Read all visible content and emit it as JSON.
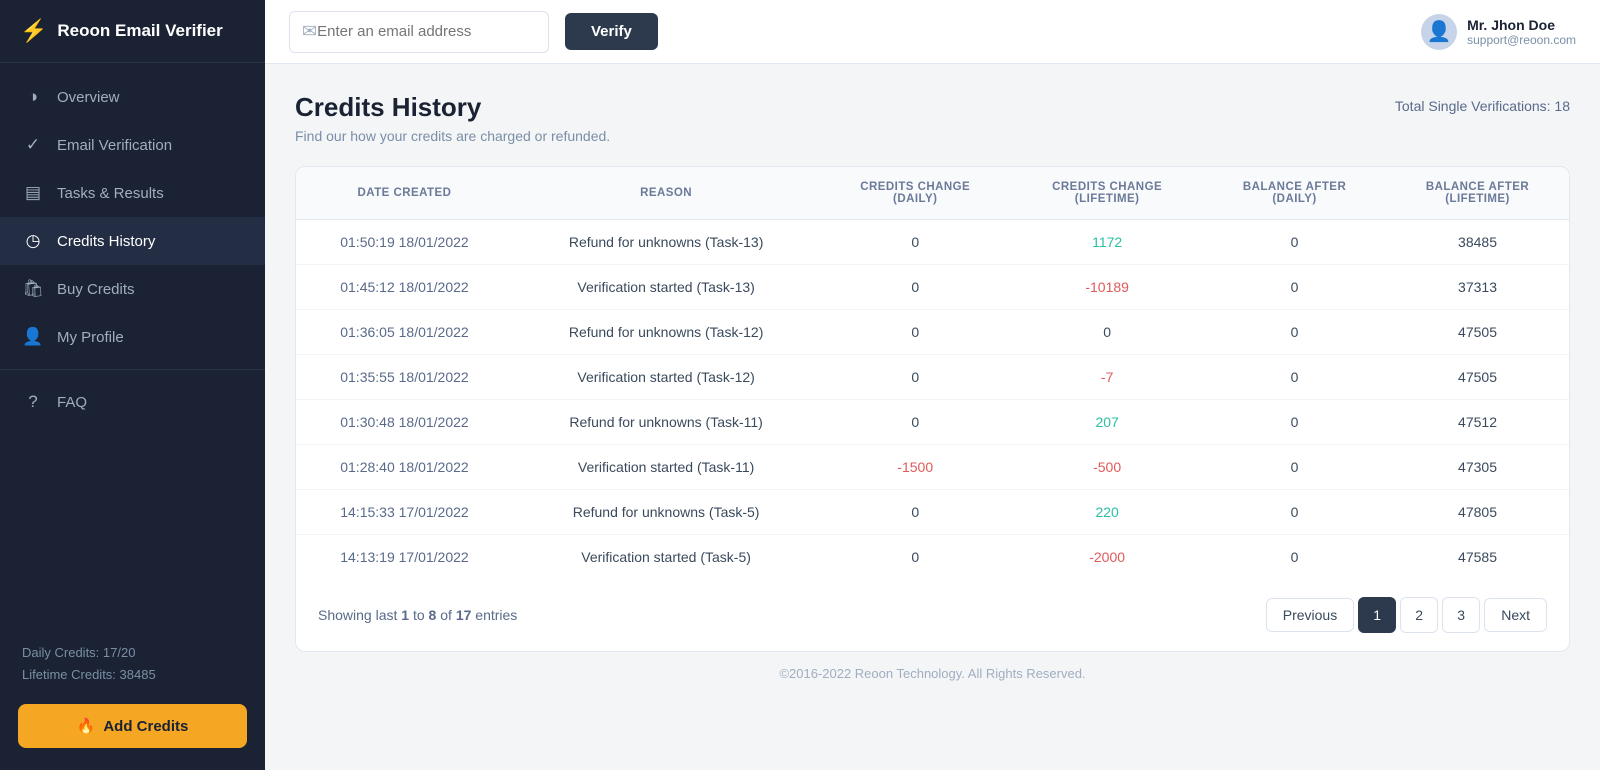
{
  "brand": {
    "name": "Reoon Email Verifier",
    "icon": "⚡"
  },
  "sidebar": {
    "nav_items": [
      {
        "id": "overview",
        "label": "Overview",
        "icon": "◑"
      },
      {
        "id": "email-verification",
        "label": "Email Verification",
        "icon": "✓"
      },
      {
        "id": "tasks-results",
        "label": "Tasks & Results",
        "icon": "▤"
      },
      {
        "id": "credits-history",
        "label": "Credits History",
        "icon": "◷",
        "active": true
      },
      {
        "id": "buy-credits",
        "label": "Buy Credits",
        "icon": "🛍"
      },
      {
        "id": "my-profile",
        "label": "My Profile",
        "icon": "👤"
      },
      {
        "id": "faq",
        "label": "FAQ",
        "icon": "?"
      }
    ],
    "daily_credits_label": "Daily Credits: 17/20",
    "lifetime_credits_label": "Lifetime Credits: 38485",
    "add_credits_label": "Add Credits",
    "add_credits_icon": "🔥"
  },
  "topbar": {
    "email_placeholder": "Enter an email address",
    "verify_label": "Verify",
    "user": {
      "name": "Mr. Jhon Doe",
      "email": "support@reoon.com"
    }
  },
  "page": {
    "title": "Credits History",
    "subtitle": "Find our how your credits are charged or refunded.",
    "total_verifications_label": "Total Single Verifications: 18"
  },
  "table": {
    "columns": [
      {
        "id": "date_created",
        "label": "DATE CREATED"
      },
      {
        "id": "reason",
        "label": "REASON"
      },
      {
        "id": "credits_change_daily",
        "label": "CREDITS CHANGE\n(DAILY)"
      },
      {
        "id": "credits_change_lifetime",
        "label": "CREDITS CHANGE\n(LIFETIME)"
      },
      {
        "id": "balance_after_daily",
        "label": "BALANCE AFTER\n(DAILY)"
      },
      {
        "id": "balance_after_lifetime",
        "label": "BALANCE AFTER\n(LIFETIME)"
      }
    ],
    "rows": [
      {
        "date": "01:50:19 18/01/2022",
        "reason": "Refund for unknowns (Task-13)",
        "credits_change_daily": "0",
        "credits_change_lifetime": "1172",
        "balance_after_daily": "0",
        "balance_after_lifetime": "38485",
        "lifetime_positive": true,
        "daily_negative": false
      },
      {
        "date": "01:45:12 18/01/2022",
        "reason": "Verification started (Task-13)",
        "credits_change_daily": "0",
        "credits_change_lifetime": "-10189",
        "balance_after_daily": "0",
        "balance_after_lifetime": "37313",
        "lifetime_positive": false,
        "daily_negative": false
      },
      {
        "date": "01:36:05 18/01/2022",
        "reason": "Refund for unknowns (Task-12)",
        "credits_change_daily": "0",
        "credits_change_lifetime": "0",
        "balance_after_daily": "0",
        "balance_after_lifetime": "47505",
        "lifetime_positive": false,
        "daily_negative": false
      },
      {
        "date": "01:35:55 18/01/2022",
        "reason": "Verification started (Task-12)",
        "credits_change_daily": "0",
        "credits_change_lifetime": "-7",
        "balance_after_daily": "0",
        "balance_after_lifetime": "47505",
        "lifetime_positive": false,
        "daily_negative": false
      },
      {
        "date": "01:30:48 18/01/2022",
        "reason": "Refund for unknowns (Task-11)",
        "credits_change_daily": "0",
        "credits_change_lifetime": "207",
        "balance_after_daily": "0",
        "balance_after_lifetime": "47512",
        "lifetime_positive": true,
        "daily_negative": false
      },
      {
        "date": "01:28:40 18/01/2022",
        "reason": "Verification started (Task-11)",
        "credits_change_daily": "-1500",
        "credits_change_lifetime": "-500",
        "balance_after_daily": "0",
        "balance_after_lifetime": "47305",
        "lifetime_positive": false,
        "daily_negative": true
      },
      {
        "date": "14:15:33 17/01/2022",
        "reason": "Refund for unknowns (Task-5)",
        "credits_change_daily": "0",
        "credits_change_lifetime": "220",
        "balance_after_daily": "0",
        "balance_after_lifetime": "47805",
        "lifetime_positive": true,
        "daily_negative": false
      },
      {
        "date": "14:13:19 17/01/2022",
        "reason": "Verification started (Task-5)",
        "credits_change_daily": "0",
        "credits_change_lifetime": "-2000",
        "balance_after_daily": "0",
        "balance_after_lifetime": "47585",
        "lifetime_positive": false,
        "daily_negative": false
      }
    ],
    "showing_text_pre": "Showing last ",
    "showing_from": "1",
    "showing_to": "8",
    "showing_of": "17",
    "showing_text_post": " entries"
  },
  "pagination": {
    "previous_label": "Previous",
    "next_label": "Next",
    "pages": [
      "1",
      "2",
      "3"
    ],
    "active_page": "1"
  },
  "footer": {
    "text": "©2016-2022 Reoon Technology. All Rights Reserved."
  }
}
